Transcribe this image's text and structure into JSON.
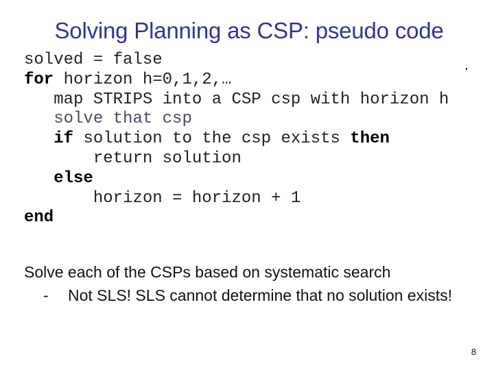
{
  "slide": {
    "title": "Solving Planning as CSP: pseudo code",
    "page_number": "8"
  },
  "code": {
    "lines": [
      {
        "indent": "",
        "kw1": "",
        "text": "solved = false",
        "kw2": ""
      },
      {
        "indent": "",
        "kw1": "for",
        "text": " horizon h=0,1,2,…",
        "kw2": ""
      },
      {
        "indent": "   ",
        "kw1": "",
        "text": "map STRIPS into a CSP csp with horizon h",
        "kw2": ""
      },
      {
        "indent": "   ",
        "kw1": "",
        "text": "solve that csp",
        "kw2": ""
      },
      {
        "indent": "   ",
        "kw1": "if",
        "text": " solution to the csp exists ",
        "kw2": "then"
      },
      {
        "indent": "       ",
        "kw1": "",
        "text": "return solution",
        "kw2": ""
      },
      {
        "indent": "   ",
        "kw1": "else",
        "text": "",
        "kw2": ""
      },
      {
        "indent": "       ",
        "kw1": "",
        "text": "horizon = horizon + 1",
        "kw2": ""
      },
      {
        "indent": "",
        "kw1": "end",
        "text": "",
        "kw2": ""
      }
    ]
  },
  "notes": {
    "main": "Solve each of the CSPs based on systematic search",
    "sub_dash": "-",
    "sub": "Not SLS! SLS cannot determine that no solution exists!"
  },
  "colors": {
    "title": "#333399",
    "text": "#222222"
  }
}
